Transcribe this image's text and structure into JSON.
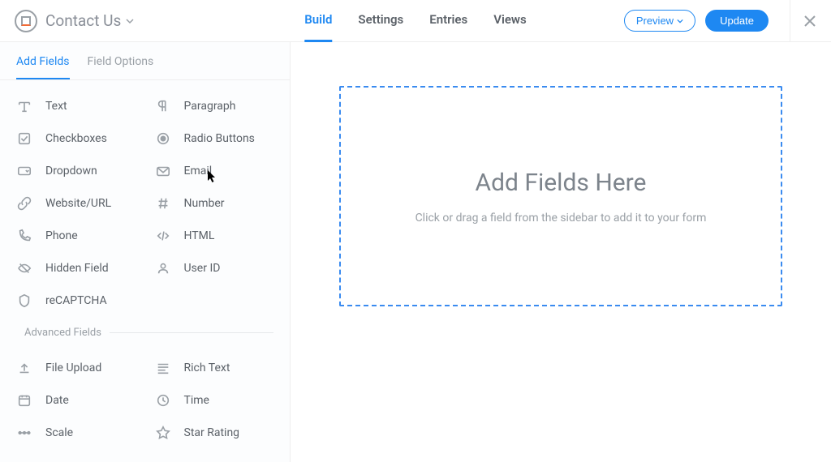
{
  "header": {
    "title": "Contact Us",
    "nav": [
      "Build",
      "Settings",
      "Entries",
      "Views"
    ],
    "active_nav": 0,
    "preview_label": "Preview",
    "update_label": "Update"
  },
  "sidebar": {
    "tabs": [
      "Add Fields",
      "Field Options"
    ],
    "active_tab": 0,
    "basic_fields": [
      {
        "icon": "text-icon",
        "label": "Text"
      },
      {
        "icon": "paragraph-icon",
        "label": "Paragraph"
      },
      {
        "icon": "checkbox-icon",
        "label": "Checkboxes"
      },
      {
        "icon": "radio-icon",
        "label": "Radio Buttons"
      },
      {
        "icon": "dropdown-icon",
        "label": "Dropdown"
      },
      {
        "icon": "email-icon",
        "label": "Email"
      },
      {
        "icon": "url-icon",
        "label": "Website/URL"
      },
      {
        "icon": "number-icon",
        "label": "Number"
      },
      {
        "icon": "phone-icon",
        "label": "Phone"
      },
      {
        "icon": "html-icon",
        "label": "HTML"
      },
      {
        "icon": "hidden-icon",
        "label": "Hidden Field"
      },
      {
        "icon": "userid-icon",
        "label": "User ID"
      },
      {
        "icon": "recaptcha-icon",
        "label": "reCAPTCHA"
      }
    ],
    "advanced_label": "Advanced Fields",
    "advanced_fields": [
      {
        "icon": "upload-icon",
        "label": "File Upload"
      },
      {
        "icon": "richtext-icon",
        "label": "Rich Text"
      },
      {
        "icon": "date-icon",
        "label": "Date"
      },
      {
        "icon": "time-icon",
        "label": "Time"
      },
      {
        "icon": "scale-icon",
        "label": "Scale"
      },
      {
        "icon": "star-icon",
        "label": "Star Rating"
      }
    ]
  },
  "main": {
    "dropzone_heading": "Add Fields Here",
    "dropzone_sub": "Click or drag a field from the sidebar to add it to your form"
  }
}
